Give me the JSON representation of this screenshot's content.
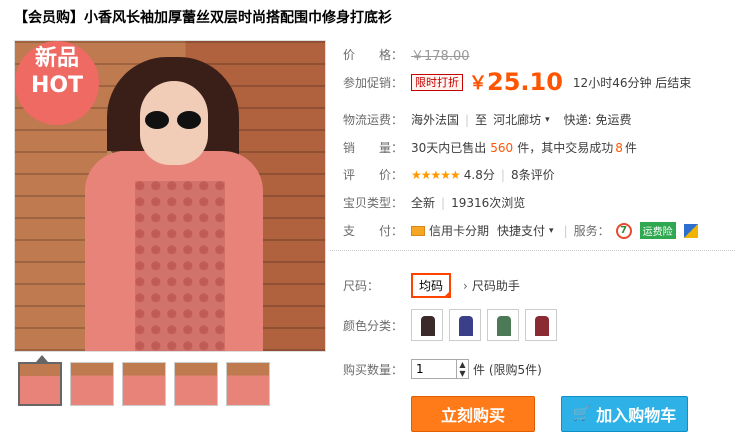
{
  "title": "【会员购】小香风长袖加厚蕾丝双层时尚搭配围巾修身打底衫",
  "badge": {
    "line1": "新品",
    "line2": "HOT"
  },
  "price": {
    "label": "价　　格：",
    "original": "￥178.00"
  },
  "promo": {
    "label": "参加促销：",
    "tag": "限时打折",
    "currency": "￥",
    "value": "25.10",
    "countdown": "12小时46分钟 后结束"
  },
  "shipping": {
    "label": "物流运费：",
    "from": "海外法国",
    "to_label": "至",
    "to": "河北廊坊",
    "fee": "快递: 免运费"
  },
  "sales": {
    "label": "销　　量：",
    "prefix": "30天内已售出",
    "sold": "560",
    "mid": "件，其中交易成功",
    "success": "8",
    "unit": "件"
  },
  "rating": {
    "label": "评　　价：",
    "stars": "★★★★★",
    "score": "4.8分",
    "reviews": "8条评价"
  },
  "type": {
    "label": "宝贝类型：",
    "condition": "全新",
    "views": "19316次浏览"
  },
  "payment": {
    "label": "支　　付：",
    "credit": "信用卡分期",
    "quick": "快捷支付",
    "service_label": "服务：",
    "service_icon_text": "7",
    "yunfeixian": "运费险"
  },
  "size": {
    "label": "尺码：",
    "selected": "均码",
    "helper": "尺码助手"
  },
  "color": {
    "label": "颜色分类：",
    "swatches": [
      "#3b2a2a",
      "#3b3f8a",
      "#4c7a56",
      "#8a2a33"
    ]
  },
  "quantity": {
    "label": "购买数量：",
    "value": "1",
    "limit": "件 (限购5件)"
  },
  "buttons": {
    "buy": "立刻购买",
    "cart": "加入购物车"
  },
  "colors": {
    "accent": "#ff5500",
    "buy": "#ff7a19",
    "cart": "#2db1e7"
  }
}
